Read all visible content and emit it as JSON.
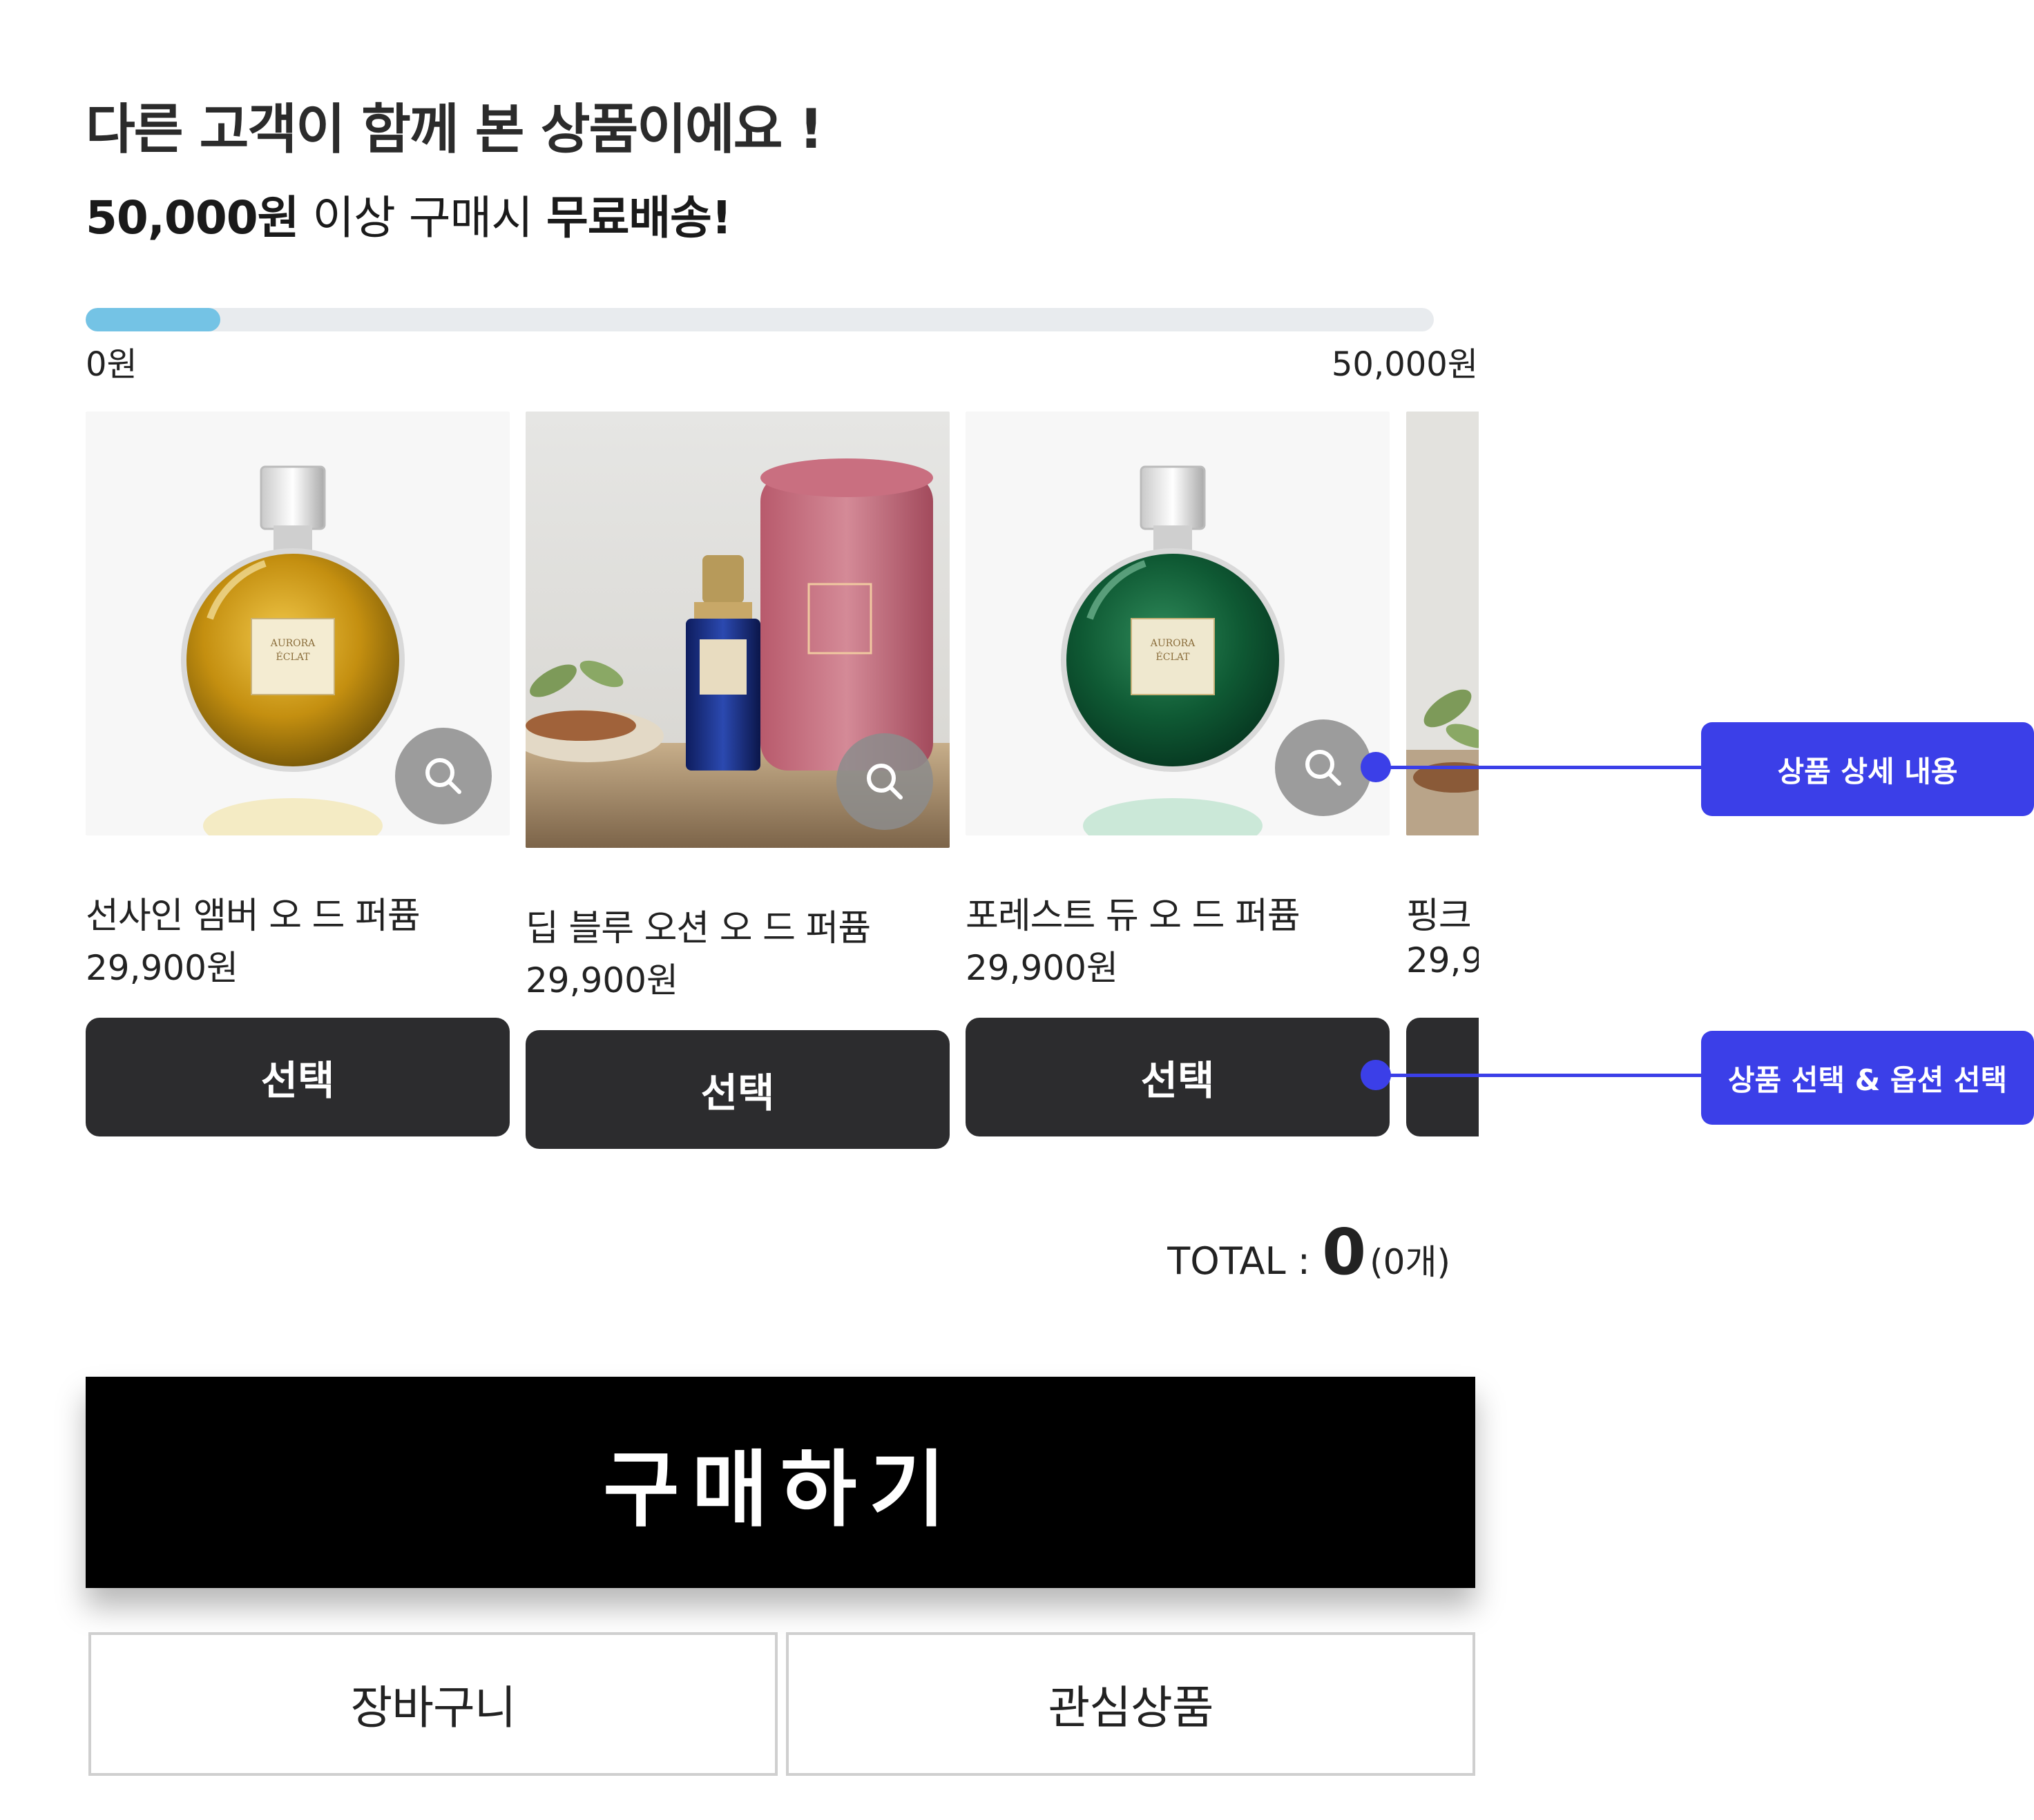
{
  "header": {
    "title": "다른 고객이 함께 본 상품이에요 !",
    "free_shipping": {
      "amount": "50,000원",
      "middle": " 이상 구매시 ",
      "emphasis": "무료배송!"
    }
  },
  "progress": {
    "value_fraction": 0.1,
    "min_label": "0원",
    "max_label": "50,000원",
    "fill_color": "#74c3e5"
  },
  "products": [
    {
      "name": "선사인 앰버 오 드 퍼퓸",
      "price": "29,900원",
      "select_label": "선택",
      "image": "gold-perfume-bottle"
    },
    {
      "name": "딥 블루 오션 오 드 퍼퓸",
      "price": "29,900원",
      "select_label": "선택",
      "image": "blue-perfume-with-pink-box"
    },
    {
      "name": "포레스트 듀 오 드 퍼퓸",
      "price": "29,900원",
      "select_label": "선택",
      "image": "green-perfume-bottle"
    },
    {
      "name": "핑크",
      "price": "29,9",
      "select_label": "",
      "image": "partial-product-photo"
    }
  ],
  "bottle_label": {
    "line1": "AURORA",
    "line2": "ÉCLAT"
  },
  "annotations": [
    {
      "label": "상품 상세 내용",
      "color": "#3b3fe8"
    },
    {
      "label": "상품 선택 & 옵션 선택",
      "color": "#3b3fe8"
    }
  ],
  "total": {
    "label": "TOTAL : ",
    "amount": "0",
    "count": "(0개)"
  },
  "buttons": {
    "buy": "구매하기",
    "cart": "장바구니",
    "wishlist": "관심상품"
  },
  "icons": {
    "zoom": "search-icon"
  }
}
